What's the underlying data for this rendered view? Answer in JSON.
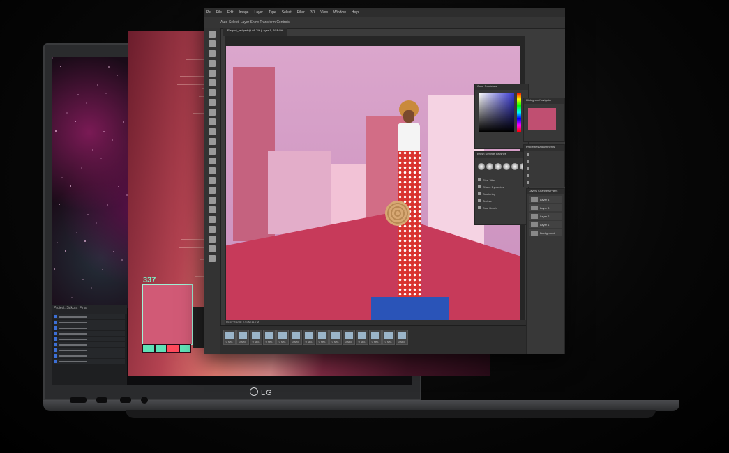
{
  "brand": {
    "logo_text": "LG"
  },
  "motion_layer": {
    "hud_number": "337"
  },
  "premiere": {
    "panel_title": "Project: Sakura_Final",
    "rows": 9
  },
  "photoshop": {
    "menu": [
      "Ps",
      "File",
      "Edit",
      "Image",
      "Layer",
      "Type",
      "Select",
      "Filter",
      "3D",
      "View",
      "Window",
      "Help"
    ],
    "options_text": "Auto-Select:  Layer    Show Transform Controls",
    "doc_tab": "Elegant_red.psd @ 66.7% (Layer 1, RGB/8#)",
    "zoom": "66.7%",
    "status": "66.67%   Doc: 2.67M/11.7M",
    "frames": [
      "0 sec.",
      "0 sec.",
      "0 sec.",
      "0 sec.",
      "0 sec.",
      "0 sec.",
      "0 sec.",
      "0 sec.",
      "0 sec.",
      "0 sec.",
      "0 sec.",
      "0 sec.",
      "0 sec.",
      "0 sec."
    ],
    "panels": {
      "color_title": "Color  Swatches",
      "brush_title": "Brush Settings  Brushes",
      "nav_title": "Histogram  Navigator",
      "props_title": "Properties  Adjustments",
      "layers_title": "Layers  Channels  Paths",
      "libraries": [
        "Size Jitter",
        "Shape Dynamics",
        "Scattering",
        "Texture",
        "Dual Brush"
      ],
      "layers": [
        "Layer 4",
        "Layer 3",
        "Layer 2",
        "Layer 1",
        "Background"
      ]
    }
  },
  "colors": {
    "accent": "#7df2c8",
    "hud": "#d15a76",
    "ps_bg": "#3b3b3b"
  }
}
